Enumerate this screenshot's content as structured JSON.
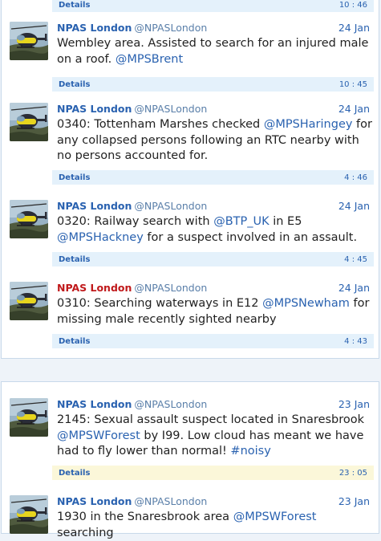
{
  "panel1": {
    "top_details": {
      "label": "Details",
      "time": "10 : 46"
    },
    "tweets": [
      {
        "name": "NPAS London",
        "handle": "@NPASLondon",
        "date": "24 Jan",
        "text_parts": [
          "Wembley area. Assisted to search for an injured male on a roof. ",
          "@MPSBrent"
        ],
        "details_label": "Details",
        "time": "10 : 45"
      },
      {
        "name": "NPAS London",
        "handle": "@NPASLondon",
        "date": "24 Jan",
        "text_parts": [
          "0340: Tottenham Marshes checked ",
          "@MPSHaringey",
          " for any collapsed persons following an RTC nearby with no persons accounted for."
        ],
        "details_label": "Details",
        "time": "4 : 46"
      },
      {
        "name": "NPAS London",
        "handle": "@NPASLondon",
        "date": "24 Jan",
        "text_parts": [
          "0320: Railway search with ",
          "@BTP_UK",
          " in E5 ",
          "@MPSHackney",
          " for a suspect involved in an assault."
        ],
        "details_label": "Details",
        "time": "4 : 45"
      },
      {
        "name": "NPAS London",
        "handle": "@NPASLondon",
        "date": "24 Jan",
        "text_parts": [
          "0310: Searching waterways in E12 ",
          "@MPSNewham",
          " for missing male recently sighted nearby"
        ],
        "details_label": "Details",
        "time": "4 : 43"
      }
    ]
  },
  "panel2": {
    "tweets": [
      {
        "name": "NPAS London",
        "handle": "@NPASLondon",
        "date": "23 Jan",
        "text_parts": [
          "2145: Sexual assault suspect located in Snaresbrook ",
          "@MPSWForest",
          " by I99. Low cloud has meant we have had to fly lower than normal! ",
          "#noisy"
        ],
        "details_label": "Details",
        "time": "23 : 05"
      },
      {
        "name": "NPAS London",
        "handle": "@NPASLondon",
        "date": "23 Jan",
        "text_parts": [
          "1930 in the Snaresbrook area ",
          "@MPSWForest",
          " searching"
        ]
      }
    ]
  },
  "colors": {
    "link": "#2a62b0",
    "name_highlight": "#c0191b",
    "details_bg": "#e4f1fb",
    "details_bg_highlight": "#fbf7d9"
  },
  "icons": {
    "avatar": "police-helicopter-icon"
  }
}
